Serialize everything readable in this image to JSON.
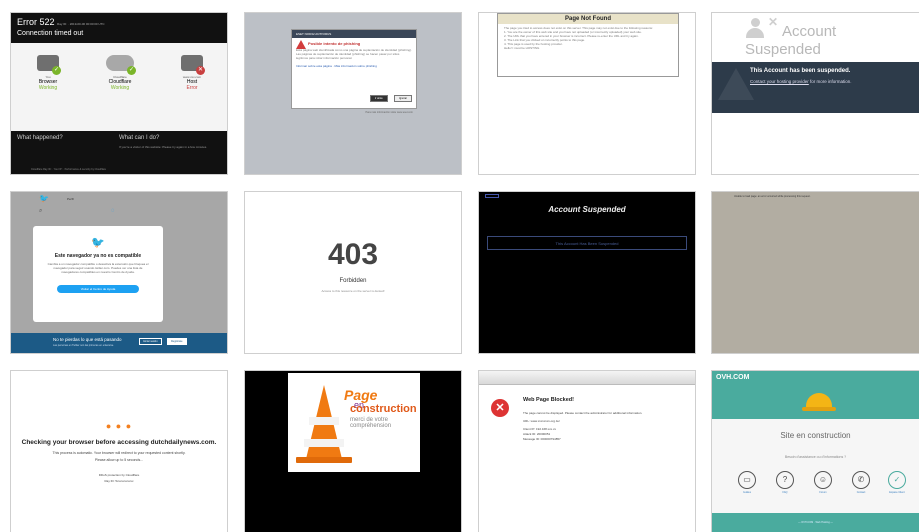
{
  "tiles": {
    "cf522": {
      "code": "Error 522",
      "code_note": "Ray ID: · 2019-00-00 00:00:00 UTC",
      "subtitle": "Connection timed out",
      "browser": {
        "small": "You",
        "name": "Browser",
        "status": "Working"
      },
      "cloudflare": {
        "small": "Cloudflare",
        "name": "Cloudflare",
        "status": "Working"
      },
      "host": {
        "small": "www.xxx.com",
        "name": "Host",
        "status": "Error"
      },
      "q1": "What happened?",
      "q2": "What can I do?",
      "q2_text": "If you're a visitor of this website: Please try again in a few minutes.",
      "footer": "Cloudflare Ray ID: · Your IP: · Performance & security by Cloudflare"
    },
    "phishing": {
      "bar": "ESET NOD32 ANTIVIRUS",
      "title": "Posible intento de phishing",
      "body": "Esta página web identificada como una página de suplantación de identidad (phishing). Las páginas de suplantación de identidad (phishing) se hacen pasar por sitios legítimos para robar información personal.",
      "links": "Informar sobre esta página · Más información sobre phishing",
      "btn_back": "Ir atrás",
      "btn_ignore": "Ignorar",
      "footer": "Para más información visite www.eset.com"
    },
    "notfound": {
      "title": "Page Not Found",
      "line1": "The page you tried to access does not exist on this server. This page may not exist due to the following reasons:",
      "line2": "1. You are the owner of this web site and you have not uploaded (or incorrectly uploaded) your web site.",
      "line3": "2. The URL that you have entered in your browser is incorrect. Please re-enter the URL and try again.",
      "line4": "3. The Link that you clicked on incorrectly points to this page.",
      "line5": "4. This page is used by the hosting provider.",
      "line6": "Hello! I must be HOSTING"
    },
    "suspended": {
      "title1": "Account",
      "title2": "Suspended",
      "msg": "This Account has been suspended.",
      "contact_link": "Contact your hosting provider",
      "contact_rest": " for more information."
    },
    "twitter": {
      "nav": "Perfil",
      "title": "Este navegador ya no es compatible",
      "body": "Cambia a un navegador compatible o desactiva la extensión que bloquea el navegador para seguir usando twitter.com. Puedes ver una lista de navegadores compatibles en nuestro Centro de Ayuda.",
      "button": "Visitar el Centro de Ayuda",
      "foot_title": "No te pierdas lo que está pasando",
      "foot_sub": "Las personas en Twitter son las primeras en enterarse.",
      "login": "Iniciar sesión",
      "signup": "Regístrate"
    },
    "forbidden": {
      "code": "403",
      "label": "Forbidden",
      "desc": "Access to this resource on the server is denied!"
    },
    "blacksusp": {
      "title": "Account Suspended",
      "box": "This Account Has Been Suspended"
    },
    "blank": {
      "line": "Unable to load page: an error occurred while processing this request."
    },
    "checking": {
      "dots": "● ● ●",
      "title": "Checking your browser before accessing dutchdailynews.com.",
      "p1": "This process is automatic. Your browser will redirect to your requested content shortly.",
      "p2": "Please allow up to 5 seconds...",
      "p3": "DDoS protection by Cloudflare",
      "p4": "Ray ID: 5xxxxxxxxxxx"
    },
    "construction": {
      "page": "Page",
      "en": "en",
      "construction": "construction",
      "merci": "merci de votre compréhension"
    },
    "blocked": {
      "title": "Web Page Blocked!",
      "l1": "The page cannot be displayed. Please contact the administrator for additional information.",
      "l2": "URL: www.xxxxxxxx.org.tw/",
      "l3": "Client IP: 192.168.xxx.xx",
      "l4": "Attack ID: 20000051",
      "l5": "Message ID: 000000794857"
    },
    "ovh": {
      "brand": "OVH.COM",
      "status": "Site en construction",
      "help": "Besoin d'assistance ou d'informations ?",
      "i1": "Guides",
      "i2": "FAQ",
      "i3": "Forum",
      "i4": "Contact",
      "i5": "Espace Client",
      "footer": "— OVH.COM · Web Hosting —"
    }
  }
}
